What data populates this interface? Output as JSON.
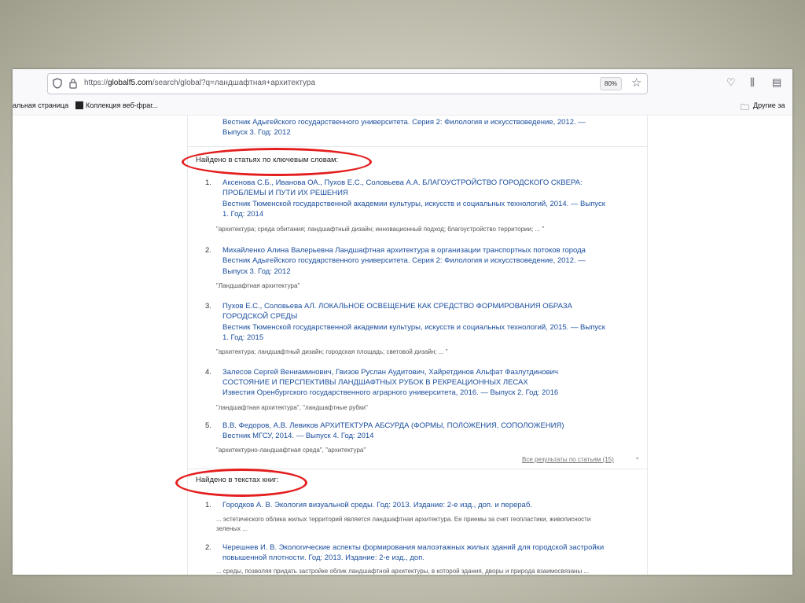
{
  "browser": {
    "url_prefix": "https://",
    "url_host": "globalf5.com",
    "url_path": "/search/global?q=ландшафтная+архитектура",
    "zoom": "80%",
    "bookmarks": [
      {
        "label": "альная страница"
      },
      {
        "label": "Коллекция веб-фраг..."
      }
    ],
    "other_bookmarks": "Другие за"
  },
  "top_result": {
    "line1": "Вестник Адыгейского государственного университета. Серия 2: Филология и искусствоведение, 2012. —",
    "line2": "Выпуск 3. Год: 2012"
  },
  "articles_section": {
    "heading": "Найдено в статьях по ключевым словам:",
    "items": [
      {
        "num": "1.",
        "title1": "Аксенова С.Б., Иванова ОА., Пухов Е.С., Соловьева А.А. БЛАГОУСТРОЙСТВО ГОРОДСКОГО СКВЕРА:",
        "title2": "ПРОБЛЕМЫ И ПУТИ ИХ РЕШЕНИЯ",
        "source1": "Вестник Тюменской государственной академии культуры, искусств и социальных технологий, 2014. — Выпуск",
        "source2": "1. Год: 2014",
        "keywords": "\"архитектура; среда обитания; ландшафтный дизайн; инновационный подход; благоустройство территории; ... \""
      },
      {
        "num": "2.",
        "title1": "Михайленко Алина Валерьевна Ландшафтная архитектура в организации транспортных потоков города",
        "source1": "Вестник Адыгейского государственного университета. Серия 2: Филология и искусствоведение, 2012. —",
        "source2": "Выпуск 3. Год: 2012",
        "keywords": "\"Ландшафтная архитектура\""
      },
      {
        "num": "3.",
        "title1": "Пухов Е.С., Соловьева АЛ. ЛОКАЛЬНОЕ ОСВЕЩЕНИЕ КАК СРЕДСТВО ФОРМИРОВАНИЯ ОБРАЗА",
        "title2": "ГОРОДСКОЙ СРЕДЫ",
        "source1": "Вестник Тюменской государственной академии культуры, искусств и социальных технологий, 2015. — Выпуск",
        "source2": "1. Год: 2015",
        "keywords": "\"архитектура; ландшафтный дизайн; городская площадь; световой дизайн; ... \""
      },
      {
        "num": "4.",
        "title1": "Залесов Сергей Вениаминович, Гвизов Руслан Аудитович, Хайретдинов Альфат Фазлутдинович",
        "title2": "СОСТОЯНИЕ И ПЕРСПЕКТИВЫ ЛАНДШАФТНЫХ РУБОК В РЕКРЕАЦИОННЫХ ЛЕСАХ",
        "source1": "Известия Оренбургского государственного аграрного университета, 2016. — Выпуск 2. Год: 2016",
        "keywords": "\"ландшафтная архитектура\", \"ландшафтные рубки\""
      },
      {
        "num": "5.",
        "title1": "В.В. Федоров, А.В. Левиков АРХИТЕКТУРА АБСУРДА (ФОРМЫ, ПОЛОЖЕНИЯ, СОПОЛОЖЕНИЯ)",
        "source1": "Вестник МГСУ, 2014. — Выпуск 4. Год: 2014",
        "keywords": "\"архитектурно-ландшафтная среда\", \"архитектура\""
      }
    ],
    "all_results": "Все результаты по статьям (15)"
  },
  "books_section": {
    "heading": "Найдено в текстах книг:",
    "items": [
      {
        "num": "1.",
        "title1": "Городков А. В. Экология визуальной среды. Год: 2013. Издание: 2-е изд., доп. и перераб.",
        "snippet1": "... эстетического облика жилых территорий является ландшафтная архитектура. Ее приемы за счет геопластики, живописности",
        "snippet2": "зеленых ..."
      },
      {
        "num": "2.",
        "title1": "Черешнев И. В. Экологические аспекты формирования малоэтажных жилых зданий для городской застройки",
        "title2": "повышенной плотности. Год: 2013. Издание: 2-е изд., доп.",
        "snippet1": "... среды, позволяя придать застройке облик ландшафтной архитектуры, в которой здания, дворы и природа взаимосвязаны ..."
      }
    ]
  },
  "colors": {
    "link": "#1a4d9c",
    "annotation_circle": "#e41e1e"
  }
}
